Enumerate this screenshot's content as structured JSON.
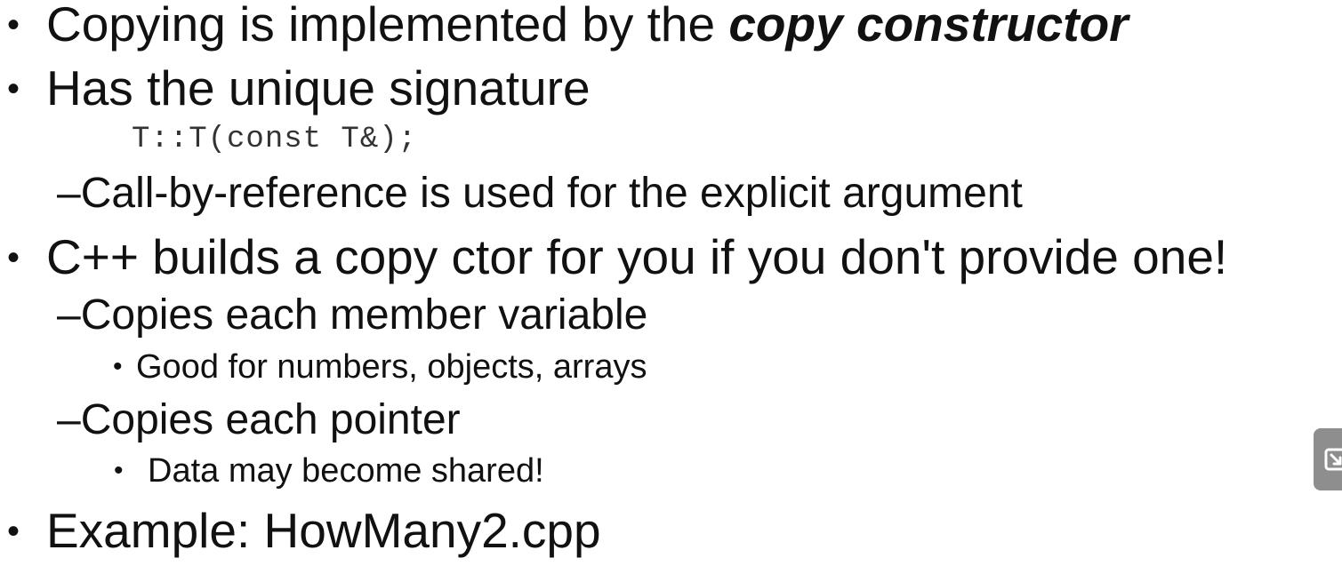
{
  "slide": {
    "items": [
      {
        "bullet": "•",
        "text_before": "Copying is implemented by the ",
        "emphasis": "copy constructor"
      },
      {
        "bullet": "•",
        "text": "Has the unique signature"
      },
      {
        "code": "T::T(const T&);"
      },
      {
        "dash": "–",
        "text": "Call-by-reference is used for the explicit argument"
      },
      {
        "bullet": "•",
        "text": "C++ builds a copy ctor for you if you don't provide one!"
      },
      {
        "dash": "–",
        "text": "Copies each member variable"
      },
      {
        "bullet": "•",
        "text": "Good for numbers, objects, arrays"
      },
      {
        "dash": "–",
        "text": "Copies each pointer"
      },
      {
        "bullet": "•",
        "text": "Data may become shared!"
      },
      {
        "bullet": "•",
        "text": "Example: HowMany2.cpp"
      }
    ]
  },
  "overlay": {
    "icon": "exit-fullscreen-icon",
    "color": "#8e8e8e"
  }
}
